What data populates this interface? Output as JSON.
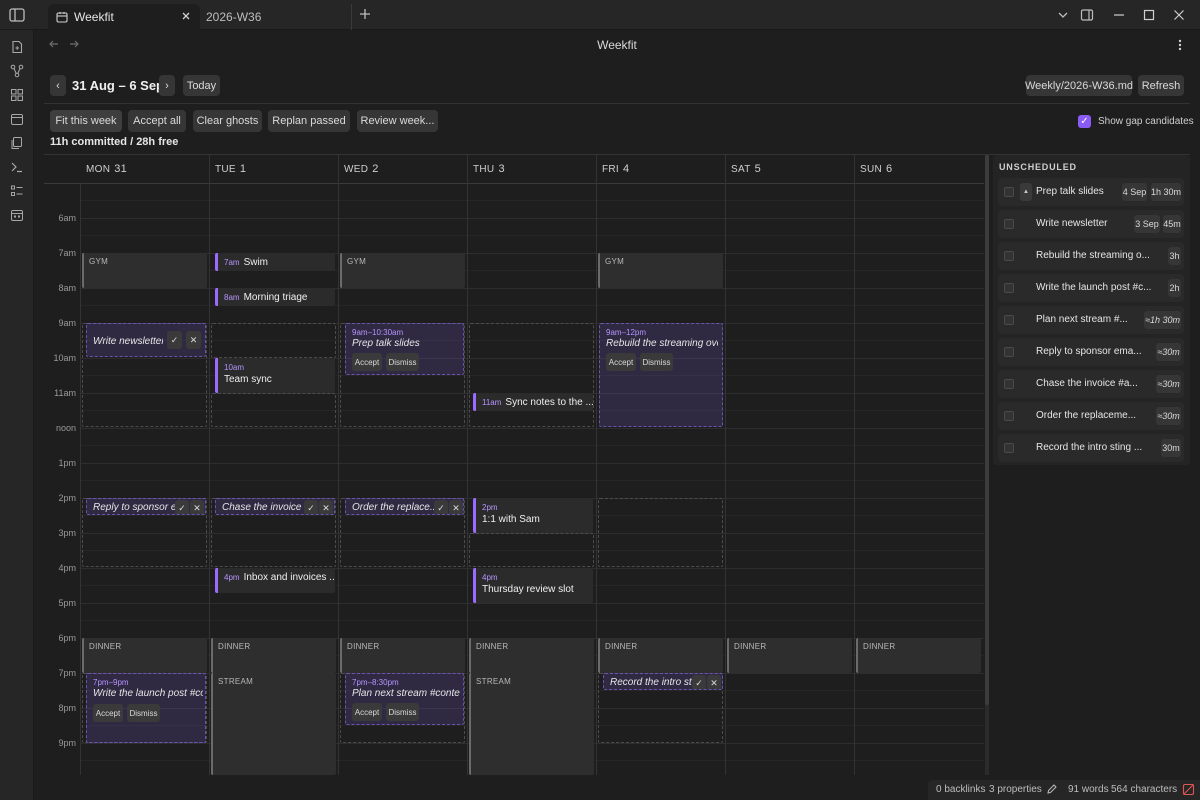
{
  "tabs": [
    {
      "label": "Weekfit",
      "active": true
    },
    {
      "label": "2026-W36",
      "active": false
    }
  ],
  "icons": {
    "sidebar_toggle": "sidebar-toggle-icon",
    "new_tab": "plus-icon",
    "tab_list": "chevron-down-icon",
    "split": "split-view-icon",
    "minimize": "minimize-icon",
    "maximize": "maximize-icon",
    "close": "close-icon",
    "ribbon": [
      "new-note-icon",
      "graph-icon",
      "canvas-icon",
      "calendar-icon",
      "templates-icon",
      "terminal-icon",
      "tasks-icon",
      "weekly-planner-icon"
    ]
  },
  "header": {
    "title": "Weekfit"
  },
  "toolbar": {
    "prev": "‹",
    "range": "31 Aug – 6 Sep",
    "next": "›",
    "today": "Today",
    "note_file": "Weekly/2026-W36.md",
    "refresh": "Refresh",
    "actions": [
      "Fit this week",
      "Accept all",
      "Clear ghosts",
      "Replan passed",
      "Review week..."
    ],
    "show_gap_candidates": "Show gap candidates",
    "show_gap_checked": true,
    "summary": "11h committed / 28h free"
  },
  "days": [
    {
      "dow": "MON",
      "num": "31"
    },
    {
      "dow": "TUE",
      "num": "1"
    },
    {
      "dow": "WED",
      "num": "2"
    },
    {
      "dow": "THU",
      "num": "3"
    },
    {
      "dow": "FRI",
      "num": "4"
    },
    {
      "dow": "SAT",
      "num": "5"
    },
    {
      "dow": "SUN",
      "num": "6"
    }
  ],
  "hours": [
    "6am",
    "7am",
    "8am",
    "9am",
    "10am",
    "11am",
    "noon",
    "1pm",
    "2pm",
    "3pm",
    "4pm",
    "5pm",
    "6pm",
    "7pm",
    "8pm",
    "9pm"
  ],
  "blocks": {
    "gym": "GYM",
    "dinner": "DINNER",
    "stream": "STREAM"
  },
  "tasks": {
    "swim": {
      "time": "7am",
      "title": "Swim"
    },
    "triage": {
      "time": "8am",
      "title": "Morning triage"
    },
    "team_sync": {
      "time": "10am",
      "title": "Team sync"
    },
    "sync_notes": {
      "time": "11am",
      "title": "Sync notes to the ..."
    },
    "one_on_one": {
      "time": "2pm",
      "title": "1:1 with Sam"
    },
    "inbox": {
      "time": "4pm",
      "title": "Inbox and invoices ..."
    },
    "thursday_review": {
      "time": "4pm",
      "title": "Thursday review slot"
    }
  },
  "ghosts": {
    "write_newsletter": {
      "title": "Write newsletter"
    },
    "prep_talk": {
      "time": "9am–10:30am",
      "title": "Prep talk slides"
    },
    "rebuild_streaming": {
      "time": "9am–12pm",
      "title": "Rebuild the streaming ove..."
    },
    "reply_sponsor": {
      "title": "Reply to sponsor e..."
    },
    "chase_invoice": {
      "title": "Chase the invoice ..."
    },
    "order_replace": {
      "title": "Order the replace..."
    },
    "launch_post": {
      "time": "7pm–9pm",
      "title": "Write the launch post #co..."
    },
    "plan_stream": {
      "time": "7pm–8:30pm",
      "title": "Plan next stream #content"
    },
    "record_intro": {
      "title": "Record the intro sti..."
    },
    "accept": "Accept",
    "dismiss": "Dismiss",
    "check": "✓",
    "x": "✕"
  },
  "unscheduled": {
    "title": "UNSCHEDULED",
    "grip": "▲",
    "items": [
      {
        "title": "Prep talk slides",
        "date": "4 Sep",
        "duration": "1h 30m"
      },
      {
        "title": "Write newsletter",
        "date": "3 Sep",
        "duration": "45m"
      },
      {
        "title": "Rebuild the streaming o...",
        "duration": "3h"
      },
      {
        "title": "Write the launch post #c...",
        "duration": "2h"
      },
      {
        "title": "Plan next stream #...",
        "duration": "≈1h 30m"
      },
      {
        "title": "Reply to sponsor ema...",
        "duration": "≈30m"
      },
      {
        "title": "Chase the invoice #a...",
        "duration": "≈30m"
      },
      {
        "title": "Order the replaceme...",
        "duration": "≈30m"
      },
      {
        "title": "Record the intro sting ...",
        "duration": "30m"
      }
    ]
  },
  "status": {
    "backlinks": "0 backlinks",
    "properties": "3 properties",
    "words": "91 words",
    "characters": "564 characters"
  }
}
